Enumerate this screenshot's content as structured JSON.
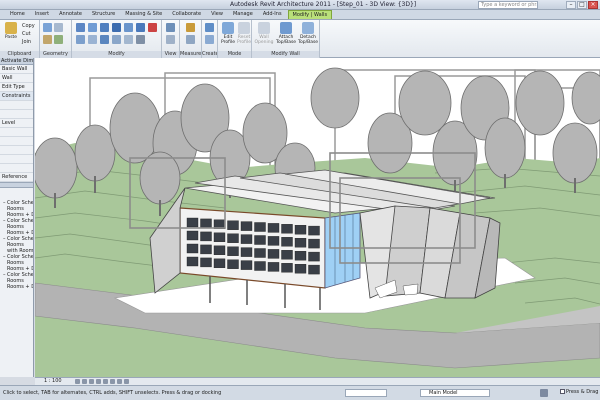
{
  "window": {
    "title": "Autodesk Revit Architecture 2011 - [Step_01 - 3D View: {3D}]",
    "search_placeholder": "Type a keyword or phrase"
  },
  "tabs": [
    "Home",
    "Insert",
    "Annotate",
    "Structure",
    "Massing & Site",
    "Collaborate",
    "View",
    "Manage",
    "Add-Ins",
    "Modify | Walls"
  ],
  "active_tab_index": 9,
  "ribbon": {
    "clipboard": {
      "paste_label": "Paste",
      "copy_label": "Copy",
      "cut_label": "Cut",
      "join_label": "Join",
      "panel_label": "Clipboard"
    },
    "geometry": {
      "panel_label": "Geometry"
    },
    "modify": {
      "panel_label": "Modify"
    },
    "view": {
      "panel_label": "View"
    },
    "measure": {
      "panel_label": "Measure"
    },
    "create": {
      "panel_label": "Create"
    },
    "mode": {
      "edit_label": "Edit Profile",
      "reset_label": "Reset Profile",
      "panel_label": "Mode"
    },
    "modify_wall": {
      "wall_opening_label": "Wall Opening",
      "attach_label": "Attach Top/Base",
      "detach_label": "Detach Top/Base",
      "panel_label": "Modify Wall"
    }
  },
  "properties_panel": {
    "header": "Activate Dimensions",
    "type_label": "Basic Wall",
    "type_value": "Wall",
    "edit_type_label": "Edit Type",
    "constraints_label": "Constraints",
    "level_label": "Level",
    "reference_label": "Reference",
    "tree_items": [
      "Color Schemes",
      "Rooms",
      "Rooms + Dept",
      "Color Schemes",
      "Rooms",
      "Rooms + Dept",
      "Color Schemes",
      "Rooms",
      "with Rooms",
      "Color Schemes",
      "Rooms",
      "Rooms + Dept",
      "Color Schemes",
      "Rooms",
      "Rooms + Dept"
    ]
  },
  "view_control": {
    "scale": "1 : 100"
  },
  "status_bar": {
    "message": "Click to select, TAB for alternates, CTRL adds, SHIFT unselects. Press & drag or docking",
    "model_selector": "Main Model",
    "press_drag_label": "Press & Drag"
  },
  "colors": {
    "ground_green": "#a9c79a",
    "terrain_dark": "#7f9a74",
    "tree_gray": "#b5b5b5",
    "selection_gray": "#8c8c8c",
    "curtain_blue": "#9fd0f5",
    "road_gray": "#b3b3b3",
    "context_tab": "#b9e07a"
  }
}
